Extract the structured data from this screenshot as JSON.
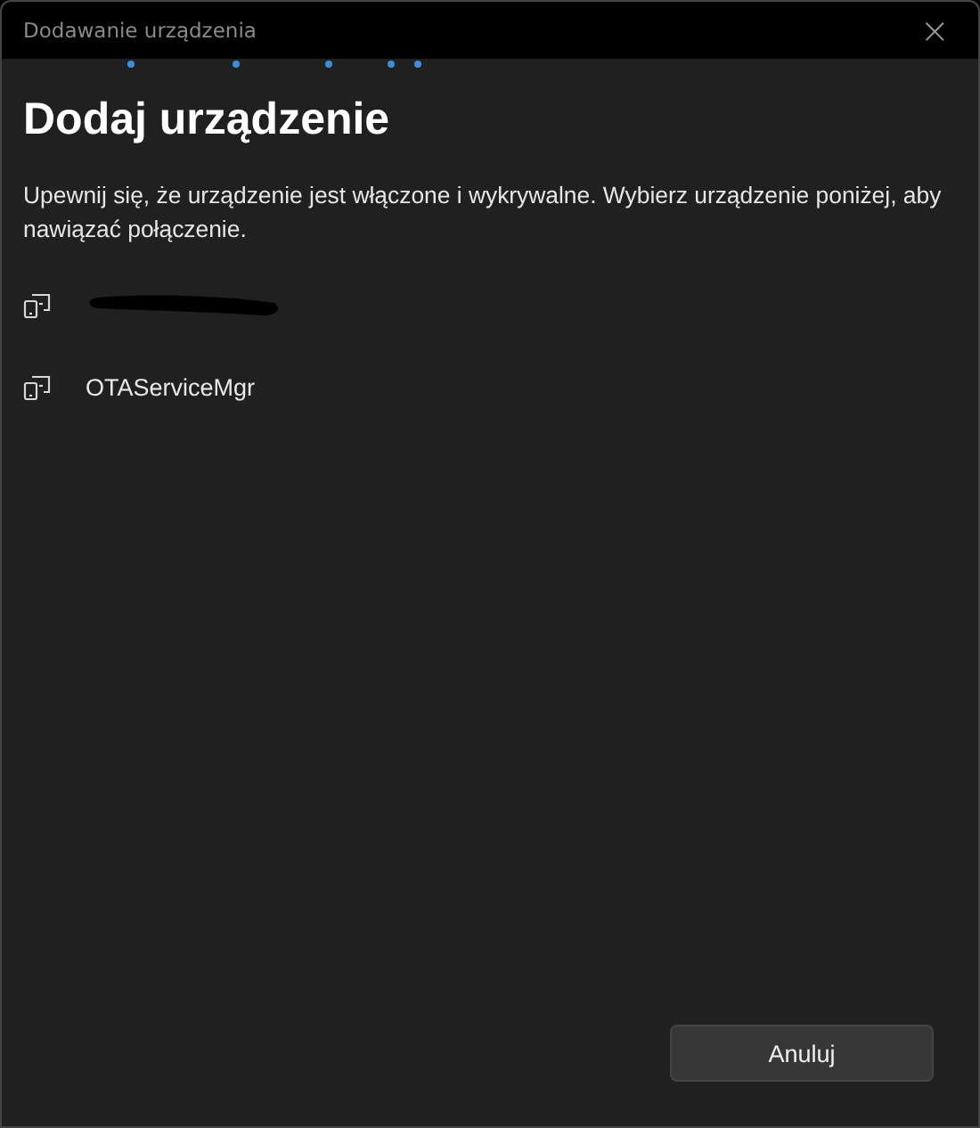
{
  "window": {
    "title": "Dodawanie urządzenia",
    "close": "×"
  },
  "heading": "Dodaj urządzenie",
  "description": "Upewnij się, że urządzenie jest włączone i wykrywalne. Wybierz urządzenie poniżej, aby nawiązać połączenie.",
  "devices": [
    {
      "kind": "redacted"
    },
    {
      "kind": "named",
      "name": "OTAServiceMgr"
    }
  ],
  "buttons": [
    {
      "label": "Anuluj"
    }
  ]
}
